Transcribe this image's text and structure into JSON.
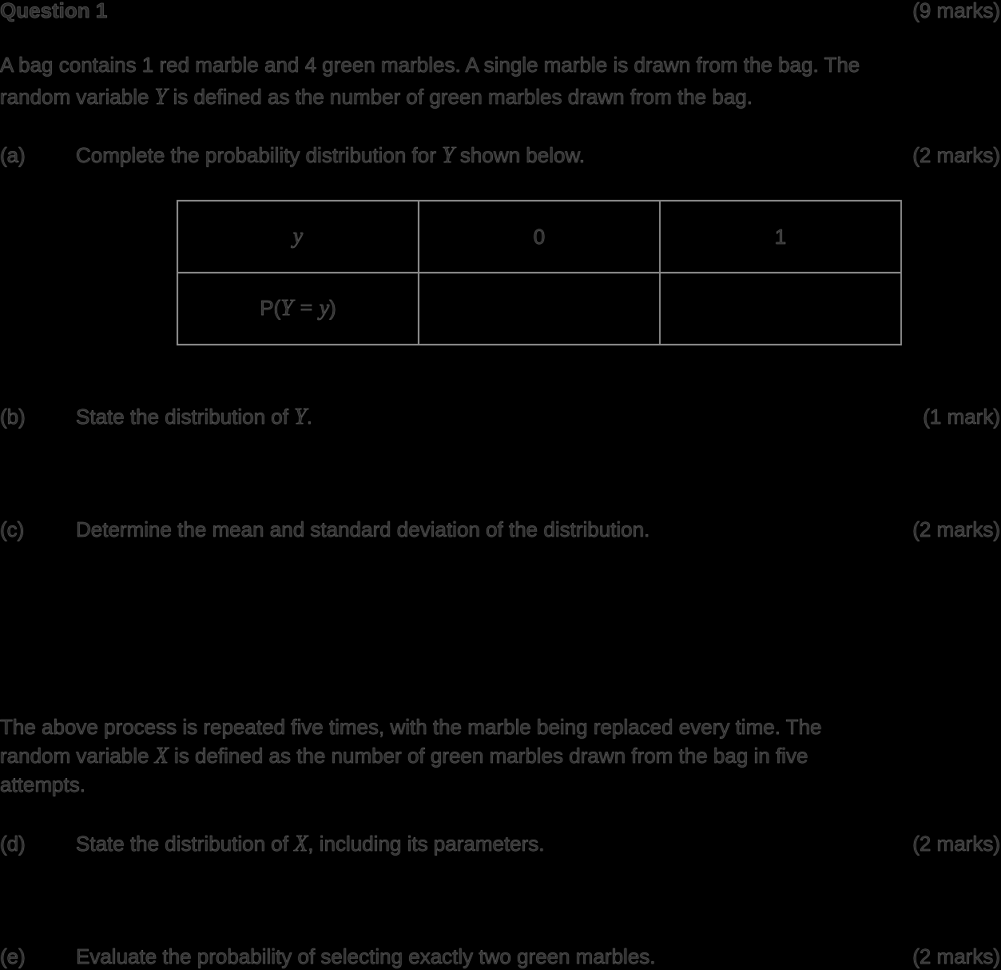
{
  "header": {
    "title": "Question 1",
    "marks": "(9 marks)"
  },
  "intro": {
    "line1": "A bag contains 1 red marble and 4 green marbles. A single marble is drawn from the bag. The",
    "line2_a": "random variable ",
    "line2_var": "Y",
    "line2_b": " is defined as the number of green marbles drawn from the bag."
  },
  "part_a": {
    "label": "(a)",
    "text_a": "Complete the probability distribution for ",
    "var": "Y",
    "text_b": " shown below.",
    "marks": "(2 marks)"
  },
  "table": {
    "row1": {
      "header": "y",
      "c1": "0",
      "c2": "1"
    },
    "row2": {
      "header_a": "P(",
      "header_var1": "Y",
      "header_eq": " = ",
      "header_var2": "y",
      "header_close": ")",
      "c1": "",
      "c2": ""
    }
  },
  "part_b": {
    "label": "(b)",
    "text_a": "State the distribution of ",
    "var": "Y",
    "text_b": ".",
    "marks": "(1 mark)"
  },
  "part_c": {
    "label": "(c)",
    "text": "Determine the mean and standard deviation of the distribution.",
    "marks": "(2 marks)"
  },
  "middle": {
    "line1": "The above process is repeated five times, with the marble being replaced every time. The",
    "line2_a": "random variable ",
    "line2_var": "X",
    "line2_b": " is defined as the number of green marbles drawn from the bag in five",
    "line3": "attempts."
  },
  "part_d": {
    "label": "(d)",
    "text_a": "State the distribution of ",
    "var": "X",
    "text_b": ", including its parameters.",
    "marks": "(2 marks)"
  },
  "part_e": {
    "label": "(e)",
    "text": "Evaluate the probability of selecting exactly two green marbles.",
    "marks": "(2 marks)"
  }
}
